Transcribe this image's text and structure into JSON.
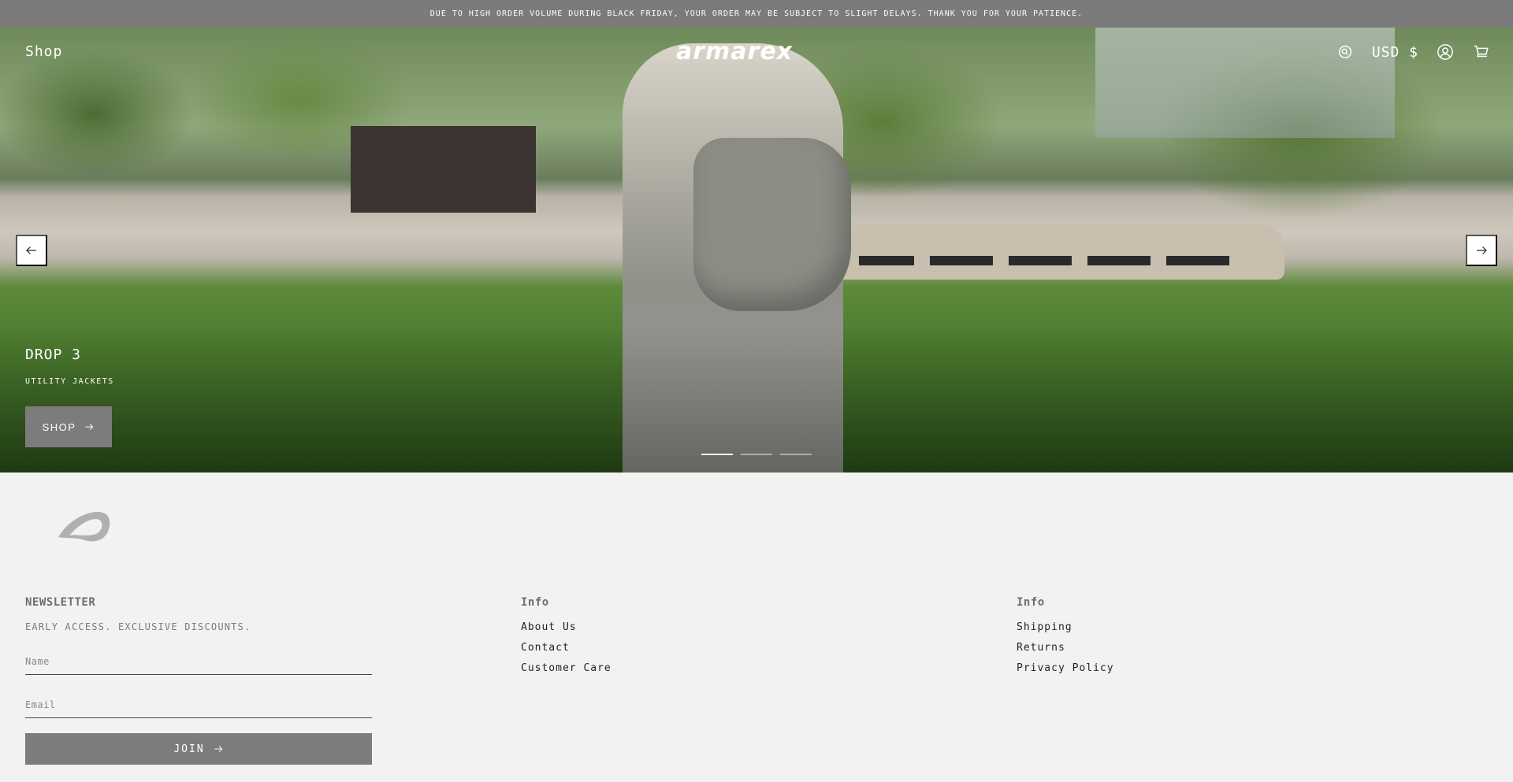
{
  "announcement": "DUE TO HIGH ORDER VOLUME DURING BLACK FRIDAY, YOUR ORDER MAY BE SUBJECT TO SLIGHT DELAYS. THANK YOU FOR YOUR PATIENCE.",
  "header": {
    "shop_label": "Shop",
    "logo": "armarex",
    "currency": "USD $",
    "icons": [
      "search-icon",
      "account-icon",
      "cart-icon"
    ]
  },
  "hero": {
    "title": "DROP 3",
    "subtitle": "UTILITY JACKETS",
    "button_label": "SHOP",
    "slides_count": 3,
    "active_slide": 1
  },
  "footer": {
    "newsletter": {
      "heading": "NEWSLETTER",
      "tagline": "EARLY ACCESS. EXCLUSIVE DISCOUNTS.",
      "name_placeholder": "Name",
      "email_placeholder": "Email",
      "join_label": "JOIN"
    },
    "info1": {
      "heading": "Info",
      "links": [
        "About Us",
        "Contact",
        "Customer Care"
      ]
    },
    "info2": {
      "heading": "Info",
      "links": [
        "Shipping",
        "Returns",
        "Privacy Policy"
      ]
    }
  },
  "colors": {
    "announcement_bg": "#7b7b7b",
    "button_bg": "#7c7c7c",
    "page_bg": "#f2f2f2"
  }
}
